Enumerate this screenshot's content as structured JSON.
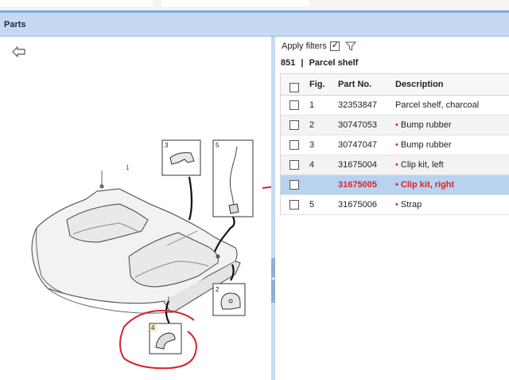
{
  "panel": {
    "title": "Parts"
  },
  "filters": {
    "label": "Apply filters",
    "checked": true
  },
  "section": {
    "id": "851",
    "separator": "|",
    "name": "Parcel shelf"
  },
  "table": {
    "headers": {
      "fig": "Fig.",
      "part": "Part No.",
      "desc": "Description"
    },
    "rows": [
      {
        "fig": "1",
        "part": "32353847",
        "desc": "Parcel shelf, charcoal",
        "bullet": "",
        "selected": false
      },
      {
        "fig": "2",
        "part": "30747053",
        "desc": "Bump rubber",
        "bullet": "•",
        "selected": false
      },
      {
        "fig": "3",
        "part": "30747047",
        "desc": "Bump rubber",
        "bullet": "•",
        "selected": false
      },
      {
        "fig": "4",
        "part": "31675004",
        "desc": "Clip kit, left",
        "bullet": "•",
        "selected": false
      },
      {
        "fig": "",
        "part": "31675005",
        "desc": "Clip kit, right",
        "bullet": "•",
        "selected": true
      },
      {
        "fig": "5",
        "part": "31675006",
        "desc": "Strap",
        "bullet": "•",
        "selected": false
      }
    ]
  },
  "diagram": {
    "callouts": {
      "shelf": "1",
      "bump2": "2",
      "bump3": "3",
      "clip4": "4",
      "strap5": "5"
    }
  },
  "colors": {
    "accent": "#c5daf2",
    "selected_row": "#b8d3f0",
    "annotation_red": "#d9232a"
  },
  "icons": {
    "back": "back-arrow-icon",
    "filter": "funnel-icon"
  }
}
